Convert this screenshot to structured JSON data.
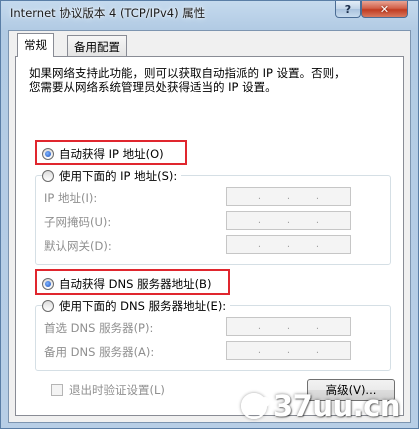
{
  "window": {
    "title": "Internet 协议版本 4 (TCP/IPv4) 属性",
    "help_label": "?",
    "close_label": "✕"
  },
  "tabs": [
    {
      "label": "常规",
      "active": true
    },
    {
      "label": "备用配置",
      "active": false
    }
  ],
  "description": {
    "line1": "如果网络支持此功能，则可以获取自动指派的 IP 设置。否则，",
    "line2": "您需要从网络系统管理员处获得适当的 IP 设置。"
  },
  "ip_section": {
    "auto_label": "自动获得 IP 地址(O)",
    "auto_selected": true,
    "manual_label": "使用下面的 IP 地址(S):",
    "manual_selected": false,
    "fields": [
      {
        "label": "IP 地址(I):",
        "value": ""
      },
      {
        "label": "子网掩码(U):",
        "value": ""
      },
      {
        "label": "默认网关(D):",
        "value": ""
      }
    ]
  },
  "dns_section": {
    "auto_label": "自动获得 DNS 服务器地址(B)",
    "auto_selected": true,
    "manual_label": "使用下面的 DNS 服务器地址(E):",
    "manual_selected": false,
    "fields": [
      {
        "label": "首选 DNS 服务器(P):",
        "value": ""
      },
      {
        "label": "备用 DNS 服务器(A):",
        "value": ""
      }
    ]
  },
  "validate_on_exit": {
    "label": "退出时验证设置(L)",
    "checked": false
  },
  "advanced_button": {
    "label": "高级(V)..."
  },
  "watermark": {
    "text": "37uu.cn"
  },
  "colors": {
    "highlight": "#e0262e",
    "radio_dot": "#1b4fbd"
  }
}
